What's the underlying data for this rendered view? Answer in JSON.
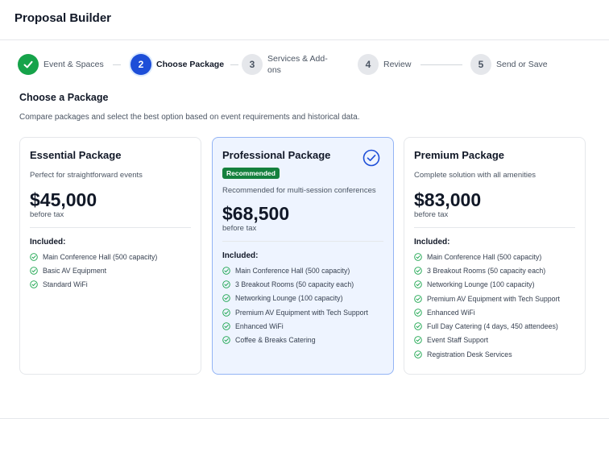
{
  "header": {
    "title": "Proposal Builder"
  },
  "stepper": {
    "steps": [
      {
        "number": "1",
        "label": "Event & Spaces",
        "state": "done"
      },
      {
        "number": "2",
        "label": "Choose Package",
        "state": "active"
      },
      {
        "number": "3",
        "label": "Services & Add-ons",
        "state": "todo"
      },
      {
        "number": "4",
        "label": "Review",
        "state": "todo"
      },
      {
        "number": "5",
        "label": "Send or Save",
        "state": "todo"
      }
    ]
  },
  "section": {
    "title": "Choose a Package",
    "subtitle": "Compare packages and select the best option based on event requirements and historical data."
  },
  "packages": [
    {
      "name": "Essential Package",
      "description": "Perfect for straightforward events",
      "price": "$45,000",
      "tax_note": "before tax",
      "included_label": "Included:",
      "features": [
        "Main Conference Hall (500 capacity)",
        "Basic AV Equipment",
        "Standard WiFi"
      ]
    },
    {
      "name": "Professional Package",
      "badge": "Recommended",
      "description": "Recommended for multi-session conferences",
      "price": "$68,500",
      "tax_note": "before tax",
      "included_label": "Included:",
      "features": [
        "Main Conference Hall (500 capacity)",
        "3 Breakout Rooms (50 capacity each)",
        "Networking Lounge (100 capacity)",
        "Premium AV Equipment with Tech Support",
        "Enhanced WiFi",
        "Coffee & Breaks Catering"
      ]
    },
    {
      "name": "Premium Package",
      "description": "Complete solution with all amenities",
      "price": "$83,000",
      "tax_note": "before tax",
      "included_label": "Included:",
      "features": [
        "Main Conference Hall (500 capacity)",
        "3 Breakout Rooms (50 capacity each)",
        "Networking Lounge (100 capacity)",
        "Premium AV Equipment with Tech Support",
        "Enhanced WiFi",
        "Full Day Catering (4 days, 450 attendees)",
        "Event Staff Support",
        "Registration Desk Services"
      ]
    }
  ],
  "colors": {
    "accent": "#1d4ed8",
    "success": "#16a34a",
    "selected_bg": "#eef4ff"
  },
  "icons": {
    "step_done": "check-icon",
    "feature": "check-circle-icon",
    "selected": "check-circle-icon"
  }
}
